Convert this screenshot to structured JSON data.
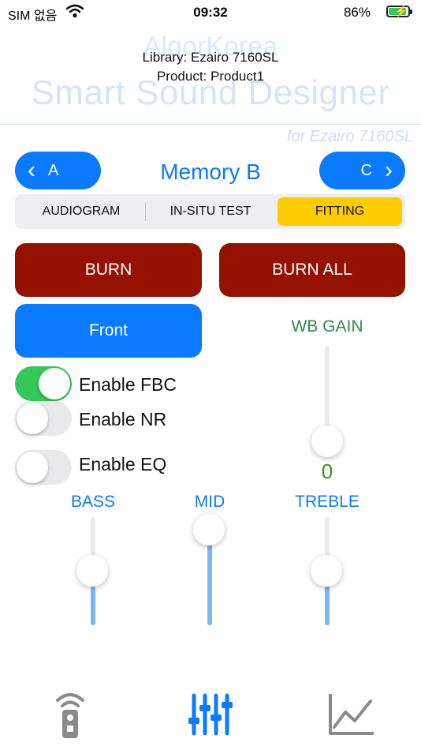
{
  "status_bar": {
    "carrier": "SIM 없음",
    "time": "09:32",
    "battery_percent": "86%"
  },
  "header": {
    "brand_watermark": "AlgorKorea",
    "app_title": "Smart Sound Designer",
    "library": "Library: Ezairo 7160SL",
    "product": "Product: Product1",
    "subtitle": "for Ezairo 7160SL"
  },
  "memory_nav": {
    "prev_label": "A",
    "title": "Memory B",
    "next_label": "C"
  },
  "tabs": {
    "items": [
      {
        "label": "AUDIOGRAM",
        "selected": false
      },
      {
        "label": "IN-SITU TEST",
        "selected": false
      },
      {
        "label": "FITTING",
        "selected": true
      }
    ]
  },
  "actions": {
    "burn": "BURN",
    "burn_all": "BURN ALL",
    "front": "Front"
  },
  "toggles": {
    "fbc": {
      "label": "Enable FBC",
      "on": true
    },
    "nr": {
      "label": "Enable NR",
      "on": false
    },
    "eq": {
      "label": "Enable EQ",
      "on": false
    }
  },
  "wb_gain": {
    "label": "WB GAIN",
    "value": "0",
    "level": 0.0
  },
  "eq_sliders": {
    "bass": {
      "label": "BASS",
      "level": 0.5
    },
    "mid": {
      "label": "MID",
      "level": 0.85
    },
    "treble": {
      "label": "TREBLE",
      "level": 0.5
    }
  },
  "bottom_tabs": {
    "remote_icon": "remote-control-icon",
    "fitting_icon": "equalizer-sliders-icon",
    "chart_icon": "line-chart-icon"
  },
  "colors": {
    "accent": "#0a7aff",
    "burn": "#941100",
    "selected_tab": "#ffcc00",
    "toggle_on": "#34c759",
    "wb_gain": "#2e8b45"
  }
}
